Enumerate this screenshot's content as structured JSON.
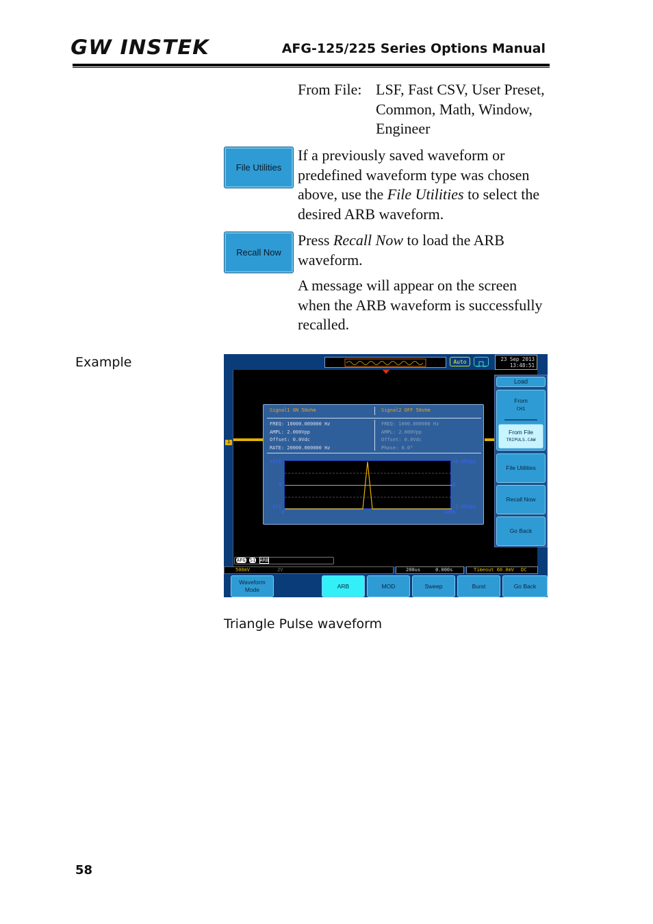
{
  "header": {
    "logo": "GW INSTEK",
    "title": "AFG-125/225 Series Options Manual"
  },
  "from_file": {
    "label": "From File:",
    "values": "LSF, Fast CSV, User Preset, Common, Math, Window, Engineer"
  },
  "steps": [
    {
      "key": "File Utilities",
      "text_before": "If a previously saved waveform or predefined waveform type was chosen above, use the ",
      "em": "File Utilities",
      "text_after": " to select the desired ARB waveform."
    },
    {
      "key": "Recall Now",
      "text_before": "Press ",
      "em": "Recall Now",
      "text_after": " to load the ARB waveform."
    }
  ],
  "message_note": "A message will appear on the screen when the ARB waveform is successfully recalled.",
  "example_label": "Example",
  "caption": "Triangle Pulse waveform",
  "page_number": "58",
  "scope": {
    "trigger_mode": "Auto",
    "date": "23 Sep 2013",
    "time": "13:48:51",
    "menu": {
      "load": "Load",
      "from": "From",
      "from_value": "CH1",
      "from_file": "From File",
      "from_file_value": "TRIPULS.CAW",
      "file_utilities": "File Utilities",
      "recall_now": "Recall Now",
      "go_back": "Go Back"
    },
    "signal1": {
      "header": "Signal1 ON 50ohm",
      "freq": "FREQ: 10000.000000 Hz",
      "ampl": "AMPL: 2.000Vpp",
      "offset": "Offset: 0.0Vdc",
      "rate": "RATE: 20000.000000 Hz"
    },
    "signal2": {
      "header": "Signal2 OFF 50ohm",
      "freq": "FREQ: 1000.000000 Hz",
      "ampl": "AMPL: 2.000Vpp",
      "offset": "Offset: 0.0Vdc",
      "phase": "Phase: 0.0°"
    },
    "graph": {
      "y_top": "+511",
      "y_mid": "0",
      "y_bot": "-511",
      "x_left": "0",
      "x_right": "4095",
      "r_top": "+2.00Vpp",
      "r_mid": "0",
      "r_bot": "-2.00Vpp"
    },
    "afg_tags": [
      "AFG",
      "S1",
      "ARB"
    ],
    "status": {
      "ch1": "500mV",
      "ch2": "2V",
      "timebase": "200us",
      "position": "0.000s",
      "trigger": "Timeout 60.0mV",
      "coupling": "DC"
    },
    "softkeys": [
      "Waveform Mode",
      "ARB",
      "MOD",
      "Sweep",
      "Burst",
      "Go Back"
    ],
    "colors": {
      "accent": "#2f9bd4",
      "selected": "#33f0f8",
      "trace": "#f0c000",
      "panel": "#2f5f9a"
    }
  }
}
